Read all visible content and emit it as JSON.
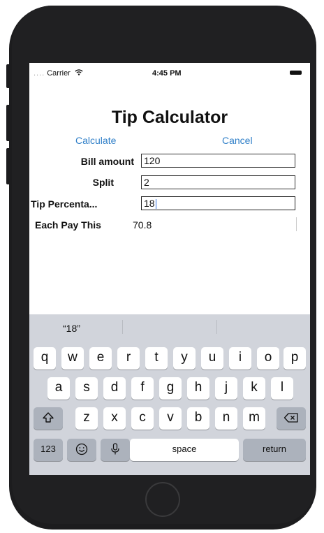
{
  "status_bar": {
    "carrier": "Carrier",
    "time": "4:45 PM"
  },
  "screen": {
    "title": "Tip Calculator",
    "calculate_label": "Calculate",
    "cancel_label": "Cancel"
  },
  "form": {
    "bill_label": "Bill amount",
    "bill_value": "120",
    "split_label": "Split",
    "split_value": "2",
    "tip_label": "Tip Percenta...",
    "tip_value": "18",
    "each_label": "Each Pay This",
    "each_value": "70.8"
  },
  "keyboard": {
    "suggestion": "“18”",
    "row1": [
      "q",
      "w",
      "e",
      "r",
      "t",
      "y",
      "u",
      "i",
      "o",
      "p"
    ],
    "row2": [
      "a",
      "s",
      "d",
      "f",
      "g",
      "h",
      "j",
      "k",
      "l"
    ],
    "row3": [
      "z",
      "x",
      "c",
      "v",
      "b",
      "n",
      "m"
    ],
    "numbers_label": "123",
    "space_label": "space",
    "return_label": "return"
  },
  "icons": [
    "wifi-icon",
    "battery-icon",
    "shift-icon",
    "backspace-icon",
    "emoji-icon",
    "microphone-icon"
  ]
}
